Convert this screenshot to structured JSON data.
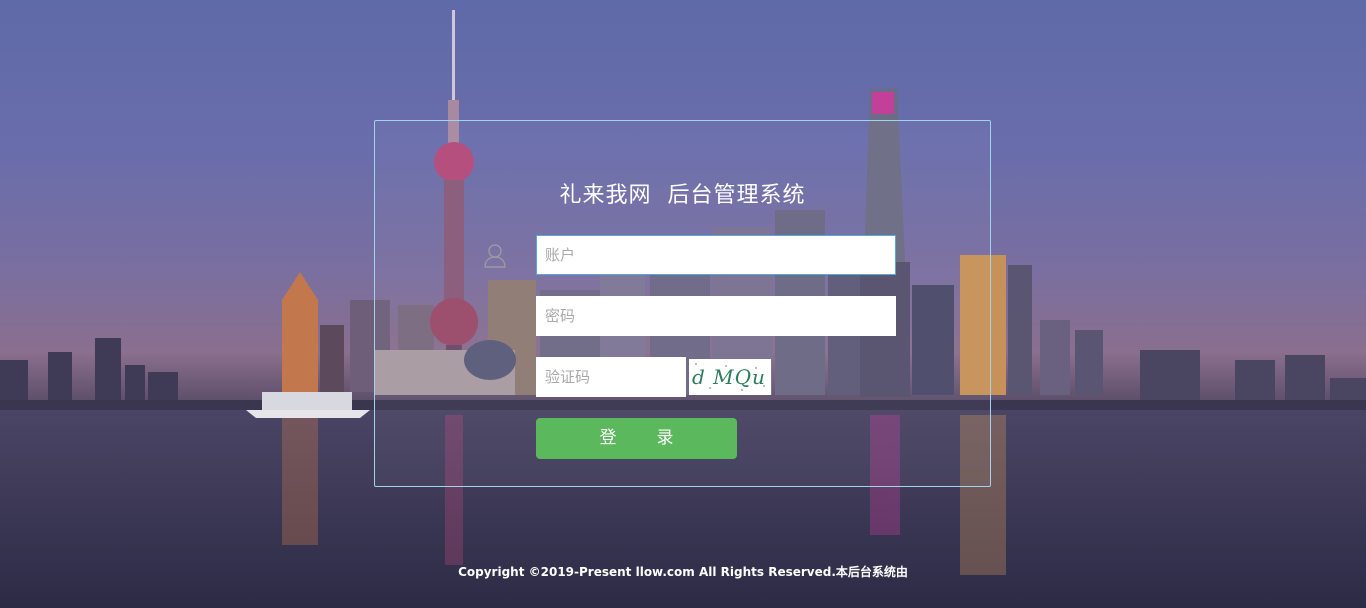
{
  "login": {
    "title": "礼来我网  后台管理系统",
    "account_placeholder": "账户",
    "password_placeholder": "密码",
    "captcha_placeholder": "验证码",
    "captcha_text": "d MQu",
    "login_label": "登录",
    "user_icon": "user-outline-icon"
  },
  "footer": {
    "copyright": "Copyright ©2019-Present llow.com All Rights Reserved.本后台系统由"
  },
  "colors": {
    "panel_border": "#9fd4ec",
    "button": "#5cb85c",
    "input_focus_border": "#56a8e0"
  }
}
